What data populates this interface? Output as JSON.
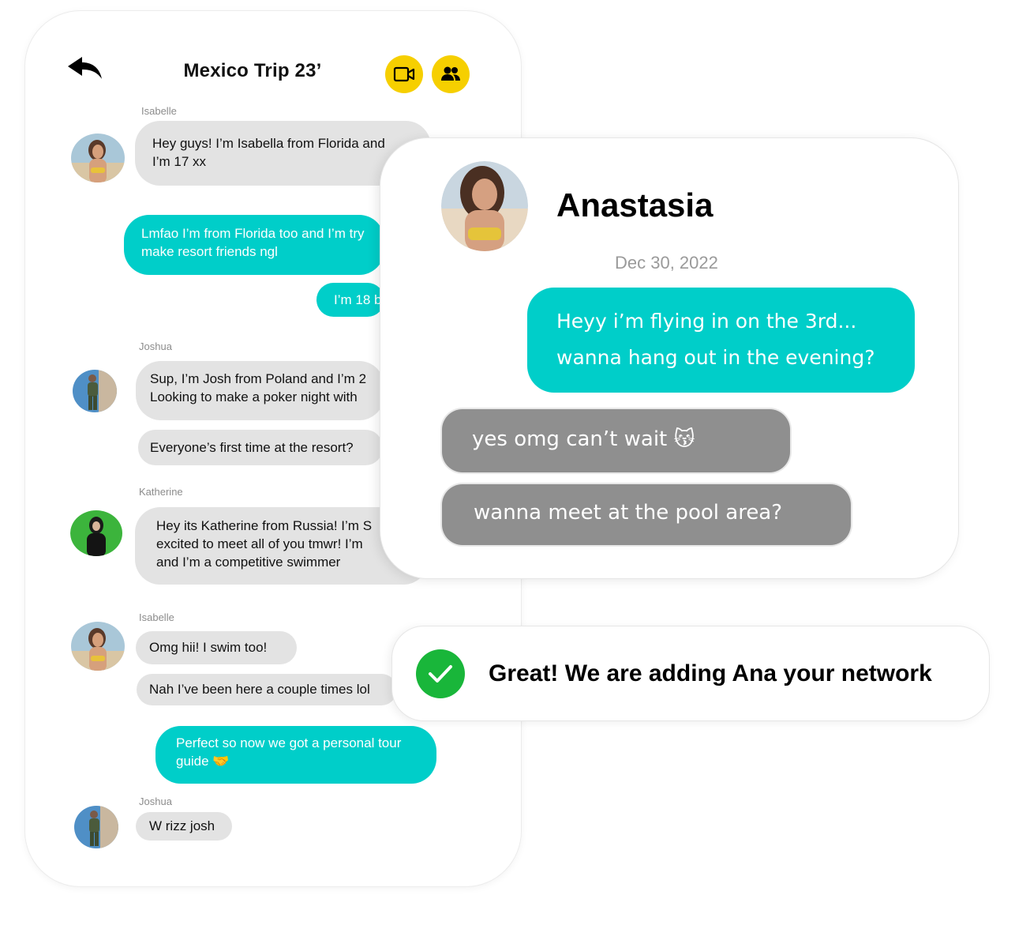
{
  "colors": {
    "accent_yellow": "#f6cf00",
    "teal_bubble": "#00cec9",
    "gray_bubble": "#e3e3e3",
    "card_gray_bubble": "#8f8f8f",
    "success_green": "#19b63a"
  },
  "header": {
    "back_icon": "back-arrow-icon",
    "title": "Mexico Trip 23’",
    "video_icon": "video-camera-icon",
    "group_icon": "group-people-icon"
  },
  "chat": {
    "senders": {
      "s1": "Isabelle",
      "s2": "Joshua",
      "s3": "Katherine",
      "s4": "Isabelle",
      "s5": "Joshua"
    },
    "messages": {
      "m1_line1": "Hey guys! I’m Isabella from Florida and",
      "m1_line2": "I’m 17 xx",
      "m2_line1": "Lmfao I’m from Florida too and I’m try",
      "m2_line2": "make resort friends ngl",
      "m3": "I’m 18 b",
      "m4_line1": "Sup, I’m Josh from Poland and I’m 2",
      "m4_line2": "Looking to make a poker night with",
      "m5": "Everyone’s first time at the resort?",
      "m6_line1": "Hey its Katherine from Russia! I’m S",
      "m6_line2": "excited to meet all of you tmwr! I’m",
      "m6_line3": "and I’m a competitive swimmer",
      "m7": "Omg hii! I swim too!",
      "m8": "Nah I’ve been here a couple times lol",
      "m9_line1": "Perfect so now we got a personal tour",
      "m9_line2": "guide 🤝",
      "m10": "W rizz josh"
    }
  },
  "card": {
    "name": "Anastasia",
    "date": "Dec 30, 2022",
    "sent_line1": "Heyy i’m flying in on the 3rd...",
    "sent_line2": "wanna hang out in the evening?",
    "reply1": "yes omg can’t wait 😽",
    "reply2": "wanna meet at the pool area?"
  },
  "toast": {
    "icon": "check-circle-icon",
    "text": "Great! We are adding Ana your network"
  }
}
